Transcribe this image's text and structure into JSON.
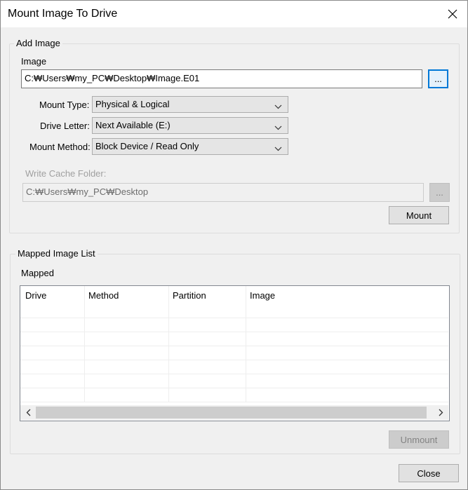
{
  "window": {
    "title": "Mount Image To Drive",
    "close_icon": "close-icon"
  },
  "add_image": {
    "group_label": "Add Image",
    "image_label": "Image",
    "image_path": "C:₩Users₩my_PC₩Desktop₩Image.E01",
    "browse_label": "...",
    "mount_type_label": "Mount Type:",
    "mount_type_value": "Physical & Logical",
    "drive_letter_label": "Drive Letter:",
    "drive_letter_value": "Next Available (E:)",
    "mount_method_label": "Mount Method:",
    "mount_method_value": "Block Device / Read Only",
    "write_cache_label": "Write Cache Folder:",
    "write_cache_path": "C:₩Users₩my_PC₩Desktop",
    "write_cache_browse_label": "...",
    "mount_button": "Mount"
  },
  "mapped": {
    "group_label": "Mapped Image List",
    "list_label": "Mapped",
    "columns": [
      "Drive",
      "Method",
      "Partition",
      "Image"
    ],
    "rows": [],
    "unmount_button": "Unmount"
  },
  "footer": {
    "close_button": "Close"
  },
  "colors": {
    "accent": "#0078d7",
    "window_bg": "#f0f0f0",
    "titlebar_bg": "#ffffff"
  }
}
